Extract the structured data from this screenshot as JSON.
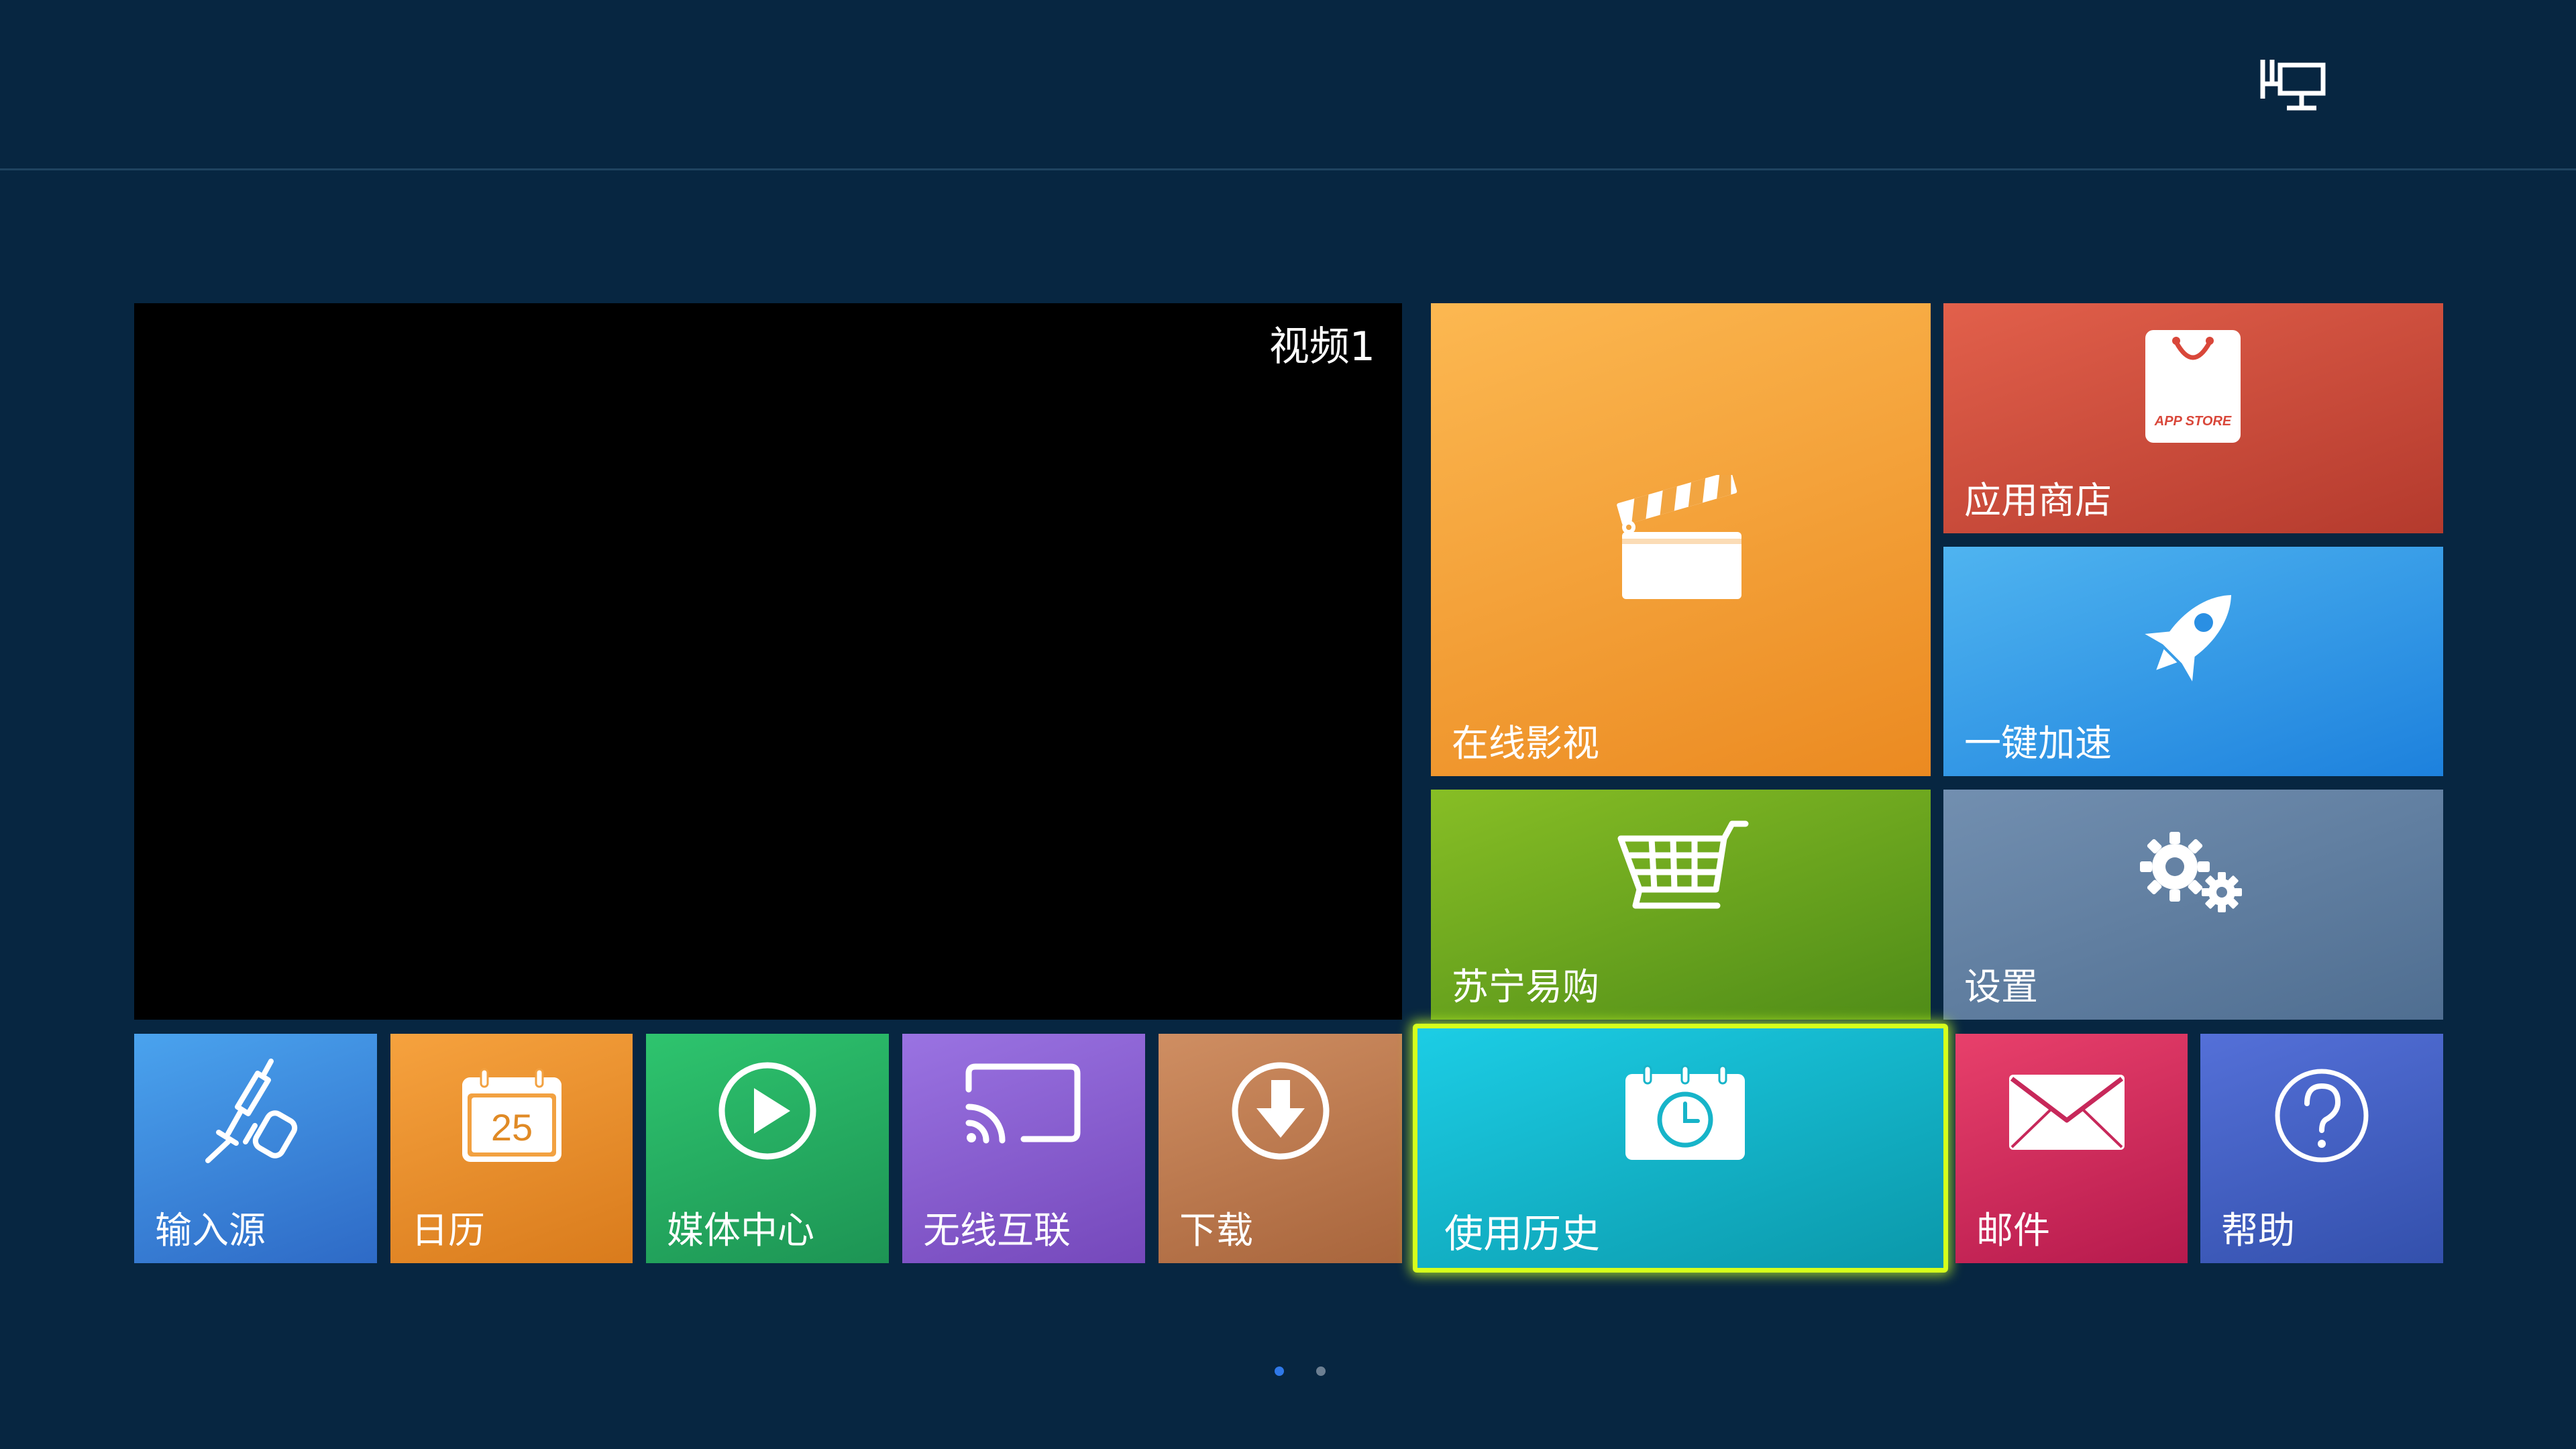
{
  "video": {
    "label": "视频1"
  },
  "tiles": {
    "online_video": {
      "label": "在线影视",
      "icon": "clapperboard-icon",
      "color_top": "#fcb851",
      "color_bottom": "#eb8a21"
    },
    "app_store": {
      "label": "应用商店",
      "icon": "shopping-bag-icon",
      "badge": "APP STORE",
      "color_top": "#e2604b",
      "color_bottom": "#b43a2d"
    },
    "boost": {
      "label": "一键加速",
      "icon": "rocket-icon",
      "color_top": "#4fb4f0",
      "color_bottom": "#1d81dd"
    },
    "suning": {
      "label": "苏宁易购",
      "icon": "shopping-cart-icon",
      "color_top": "#87be25",
      "color_bottom": "#4f8c18"
    },
    "settings": {
      "label": "设置",
      "icon": "gears-icon",
      "color_top": "#728fb0",
      "color_bottom": "#4f6e91"
    },
    "input_source": {
      "label": "输入源",
      "icon": "cable-plug-icon",
      "color_top": "#4aa3ee",
      "color_bottom": "#2e6ac6"
    },
    "calendar": {
      "label": "日历",
      "icon": "calendar-icon",
      "day": "25",
      "color_top": "#f6a23e",
      "color_bottom": "#d97b1c"
    },
    "media_center": {
      "label": "媒体中心",
      "icon": "play-circle-icon",
      "color_top": "#2ec46e",
      "color_bottom": "#1d9454"
    },
    "wireless": {
      "label": "无线互联",
      "icon": "screen-cast-icon",
      "color_top": "#9a73e2",
      "color_bottom": "#7548bb"
    },
    "download": {
      "label": "下载",
      "icon": "download-circle-icon",
      "color_top": "#cf8e62",
      "color_bottom": "#a8653c"
    },
    "history": {
      "label": "使用历史",
      "icon": "calendar-clock-icon",
      "color_top": "#1ccde5",
      "color_bottom": "#0b98aa"
    },
    "mail": {
      "label": "邮件",
      "icon": "envelope-icon",
      "color_top": "#e8406b",
      "color_bottom": "#b61a4d"
    },
    "help": {
      "label": "帮助",
      "icon": "question-circle-icon",
      "color_top": "#5470d8",
      "color_bottom": "#3350ac"
    }
  },
  "top_bar": {
    "icon": "signal-source-monitor-icon"
  },
  "pagination": {
    "total": 2,
    "active": 1,
    "active_color": "#2f78e8",
    "inactive_color": "#6c7f92"
  },
  "focus": {
    "tile": "history",
    "border_color": "#d6ff1c"
  }
}
